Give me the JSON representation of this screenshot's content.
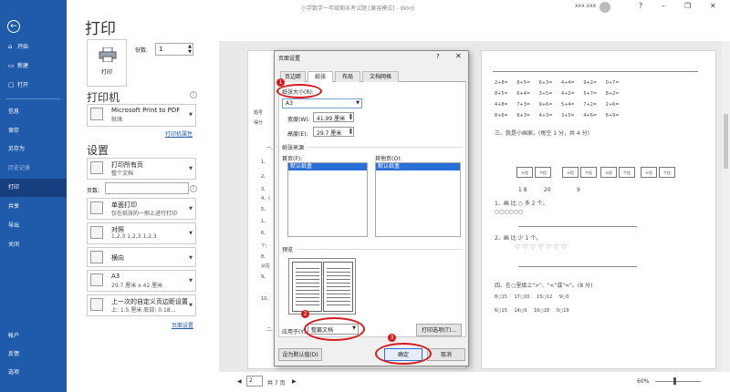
{
  "title_bar": {
    "doc_title": "小学数学一年级期末考试题 [兼容模式] - Word",
    "user": "xxx xxx",
    "controls": [
      "?",
      "–",
      "❐",
      "✕"
    ]
  },
  "sidebar": {
    "back_icon": "←",
    "items": [
      {
        "label": "开始",
        "icon": "⌂"
      },
      {
        "label": "新建",
        "icon": "▭"
      },
      {
        "label": "打开",
        "icon": "▢"
      },
      {
        "label": "信息",
        "icon": ""
      },
      {
        "label": "保存",
        "icon": ""
      },
      {
        "label": "另存为",
        "icon": ""
      },
      {
        "label": "历史记录",
        "icon": ""
      },
      {
        "label": "打印",
        "icon": ""
      },
      {
        "label": "共享",
        "icon": ""
      },
      {
        "label": "导出",
        "icon": ""
      },
      {
        "label": "关闭",
        "icon": ""
      },
      {
        "label": "帐户",
        "icon": ""
      },
      {
        "label": "反馈",
        "icon": ""
      },
      {
        "label": "选项",
        "icon": ""
      }
    ],
    "active": "打印"
  },
  "print": {
    "heading": "打印",
    "button_label": "打印",
    "copies_label": "份数:",
    "copies_value": "1",
    "printer_heading": "打印机",
    "printer_name": "Microsoft Print to PDF",
    "printer_status": "就绪",
    "printer_props": "打印机属性",
    "settings_heading": "设置",
    "setting_1": {
      "l1": "打印所有页",
      "l2": "整个文档"
    },
    "pages_label": "页数:",
    "setting_2": {
      "l1": "单面打印",
      "l2": "仅在纸张的一侧上进行打印"
    },
    "setting_3": {
      "l1": "对照",
      "l2": "1,2,3    1,2,3    1,2,3"
    },
    "setting_4": {
      "l1": "横向",
      "l2": ""
    },
    "setting_5": {
      "l1": "A3",
      "l2": "29.7 厘米 x 42 厘米"
    },
    "setting_6": {
      "l1": "上一次的自定义页边距设置",
      "l2": "上: 1.5 厘米 底部: 0.18..."
    },
    "page_setup_link": "页面设置"
  },
  "dialog": {
    "title": "页面设置",
    "help": "?",
    "close": "✕",
    "tabs": [
      "页边距",
      "纸张",
      "布局",
      "文档网格"
    ],
    "active_tab": "纸张",
    "paper_size_label": "纸张大小(R):",
    "paper_size_value": "A3",
    "width_label": "宽度(W):",
    "width_value": "41.99 厘米",
    "height_label": "高度(E):",
    "height_value": "29.7 厘米",
    "paper_source_label": "纸张来源",
    "first_page_label": "首页(F):",
    "first_page_value": "默认纸盒",
    "other_pages_label": "其他页(O):",
    "other_pages_value": "默认纸盒",
    "preview_label": "预览",
    "apply_to_label": "应用于(Y):",
    "apply_to_value": "整篇文档",
    "print_options": "打印选项(T)...",
    "set_default": "设为默认值(D)",
    "ok": "确定",
    "cancel": "取消"
  },
  "annotations": {
    "b1": "1",
    "b2": "2",
    "b3": "3"
  },
  "bottom": {
    "page_input": "2",
    "page_total": "共 7 页",
    "zoom": "60%",
    "prev": "◀",
    "next": "▶"
  },
  "preview_right": {
    "rows": [
      "2+8=  8+5=  6+3=  4+4=  9+2=  0+7=",
      "8+5=  6+4=  3+5=  4+2=  5+7=  8+2=",
      "4+8=  7+3=  9+6=  5+4=  7+2=  2+6=",
      "8+6=  6+3=  4+3=  3+5=  4+6=  6+9="
    ],
    "q3": "三、我是小画家。(每空 1 分，共 4 分)",
    "abacus": [
      "十位",
      "个位",
      "十位",
      "个位",
      "十位",
      "个位",
      "十位",
      "个位"
    ],
    "nums": [
      "1 8",
      "20",
      "9"
    ],
    "q1a": "1、画     比 ○ 多 2 个。",
    "q1b": "○○○○○○",
    "q2a": "2、画     比     少 1 个。",
    "q2b": "♡ ♡ ♡ ♡ ♡ ♡ ♡",
    "q4": "四、在○里填上\">\"、\"<\"或\"=\"。(8 分)",
    "cmp": [
      "8○15    17○20    15○12    9○0",
      "6○15    14○9    16○18    0○19"
    ]
  },
  "preview_left": {
    "lines": [
      "题号",
      "得分",
      "一、",
      "1、",
      "2、",
      "3、",
      "4、(",
      "5、",
      "1、",
      "6、",
      "7、",
      "个;",
      "8、",
      "从左",
      "9、",
      "10、",
      "二、"
    ]
  }
}
